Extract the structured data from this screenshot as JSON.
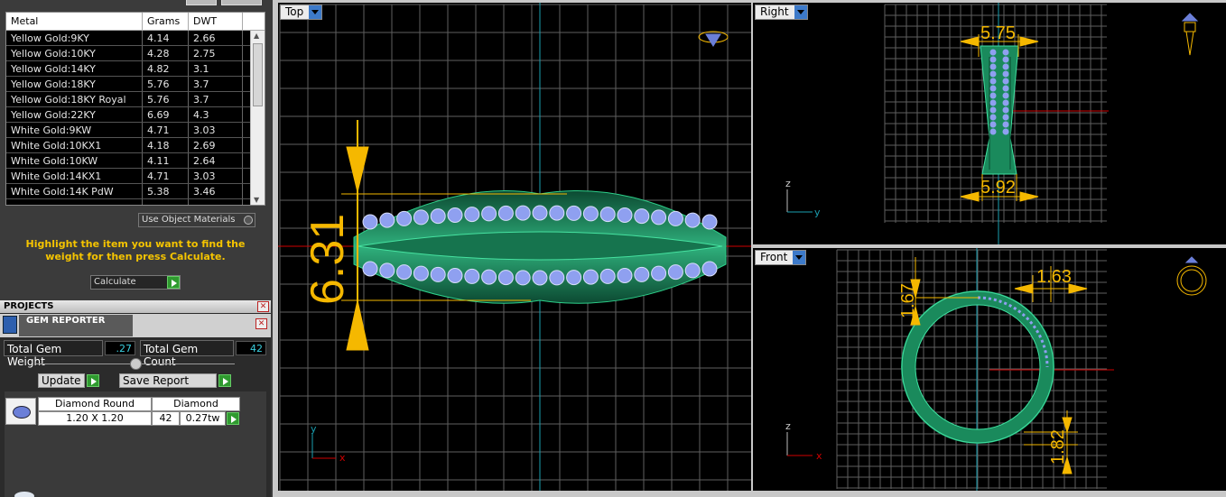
{
  "metal_table": {
    "headers": [
      "Metal",
      "Grams",
      "DWT"
    ],
    "rows": [
      [
        "Yellow Gold:9KY",
        "4.14",
        "2.66"
      ],
      [
        "Yellow Gold:10KY",
        "4.28",
        "2.75"
      ],
      [
        "Yellow Gold:14KY",
        "4.82",
        "3.1"
      ],
      [
        "Yellow Gold:18KY",
        "5.76",
        "3.7"
      ],
      [
        "Yellow Gold:18KY Royal",
        "5.76",
        "3.7"
      ],
      [
        "Yellow Gold:22KY",
        "6.69",
        "4.3"
      ],
      [
        "White Gold:9KW",
        "4.71",
        "3.03"
      ],
      [
        "White Gold:10KX1",
        "4.18",
        "2.69"
      ],
      [
        "White Gold:10KW",
        "4.11",
        "2.64"
      ],
      [
        "White Gold:14KX1",
        "4.71",
        "3.03"
      ],
      [
        "White Gold:14K PdW",
        "5.38",
        "3.46"
      ]
    ]
  },
  "use_object_materials_label": "Use Object Materials",
  "hint_text": "Highlight the item you want to find the weight for then press Calculate.",
  "calculate_label": "Calculate",
  "projects_label": "PROJECTS",
  "gem_reporter": {
    "title": "GEM REPORTER",
    "total_weight_label": "Total Gem Weight",
    "total_weight_value": ".27",
    "total_count_label": "Total Gem Count",
    "total_count_value": "42",
    "update_label": "Update",
    "save_report_label": "Save Report",
    "gem_name": "Diamond Round",
    "gem_type": "Diamond",
    "gem_size": "1.20 X 1.20",
    "gem_count": "42",
    "gem_weight": "0.27tw"
  },
  "viewports": {
    "top": {
      "label": "Top",
      "dim_height": "6.31",
      "axis_y": "y",
      "axis_x": "x"
    },
    "right": {
      "label": "Right",
      "dim_top": "5.75",
      "dim_bottom": "5.92",
      "axis_z": "z",
      "axis_y": "y"
    },
    "front": {
      "label": "Front",
      "dim_left": "1.67",
      "dim_right": "1.63",
      "dim_bottom": "1.82",
      "axis_z": "z",
      "axis_x": "x"
    }
  },
  "colors": {
    "ring_green": "#1a8a5c",
    "gem_blue": "#8fa0f0",
    "dimension_yellow": "#f5b800",
    "grid_line": "#6a6a6a",
    "axis_cyan": "#1a9fb0",
    "axis_red": "#d00000"
  }
}
